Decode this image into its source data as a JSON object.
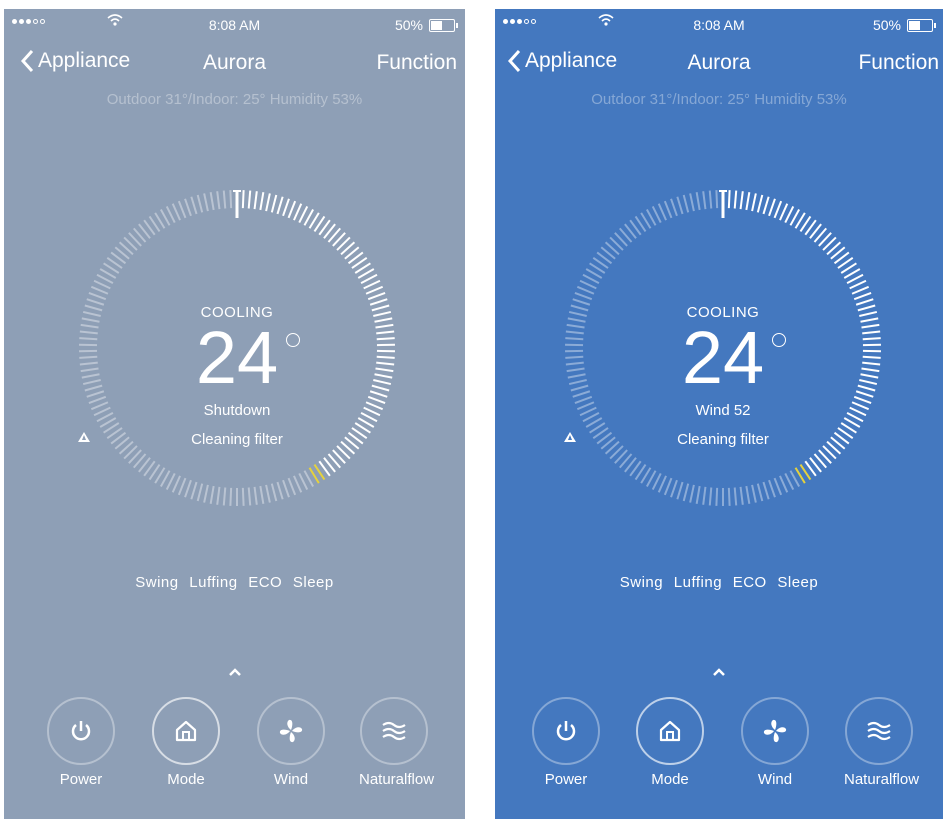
{
  "screens": [
    {
      "status_bar": {
        "time": "8:08 AM",
        "battery": "50%"
      },
      "nav": {
        "back_label": "Appliance",
        "title": "Aurora",
        "function_label": "Function"
      },
      "info": "Outdoor 31°/Indoor: 25° Humidity 53%",
      "dial": {
        "mode": "COOLING",
        "temperature": "24",
        "status": "Shutdown",
        "filter": "Cleaning filter"
      },
      "options": "Swing  Luffing  ECO  Sleep",
      "buttons": [
        {
          "label": "Power",
          "icon": "power-icon"
        },
        {
          "label": "Mode",
          "icon": "home-icon"
        },
        {
          "label": "Wind",
          "icon": "fan-icon"
        },
        {
          "label": "Naturalflow",
          "icon": "wave-icon"
        }
      ],
      "background": "#8e9fb6"
    },
    {
      "status_bar": {
        "time": "8:08 AM",
        "battery": "50%"
      },
      "nav": {
        "back_label": "Appliance",
        "title": "Aurora",
        "function_label": "Function"
      },
      "info": "Outdoor 31°/Indoor: 25° Humidity 53%",
      "dial": {
        "mode": "COOLING",
        "temperature": "24",
        "status": "Wind 52",
        "filter": "Cleaning filter"
      },
      "options": "Swing  Luffing  ECO  Sleep",
      "buttons": [
        {
          "label": "Power",
          "icon": "power-icon"
        },
        {
          "label": "Mode",
          "icon": "home-icon"
        },
        {
          "label": "Wind",
          "icon": "fan-icon"
        },
        {
          "label": "Naturalflow",
          "icon": "wave-icon"
        }
      ],
      "background": "#4478bf"
    }
  ],
  "colors": {
    "off_bg": "#8e9fb6",
    "on_bg": "#4478bf",
    "tick_active": "#ffffff",
    "tick_marker": "#e6d23c"
  }
}
